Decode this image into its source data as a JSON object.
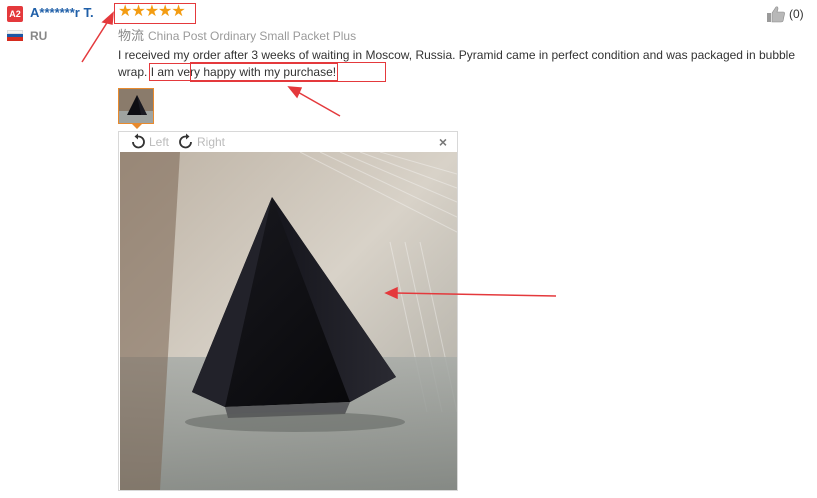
{
  "reviewer": {
    "avatar_text": "A2",
    "name": "A*******r T.",
    "country_code": "RU",
    "flag_colors": [
      "#ffffff",
      "#1c57a5",
      "#d52b1e"
    ]
  },
  "rating": {
    "stars": 5,
    "max": 5,
    "star_color": "#f39c12"
  },
  "likes": {
    "count_text": "(0)",
    "icon": "thumbs-up-icon"
  },
  "shipping": {
    "label": "物流",
    "method": "China Post Ordinary Small Packet Plus"
  },
  "review": {
    "text_before": "I received my order after 3 weeks of waiting in Moscow, Russia. Pyramid came in perfect condition and was packaged in bubble wrap. ",
    "text_highlight": "I am very happy with my purchase!"
  },
  "viewer": {
    "rotate_left_label": "Left",
    "rotate_right_label": "Right",
    "close_label": "×"
  },
  "annotation_color": "#e4393c"
}
